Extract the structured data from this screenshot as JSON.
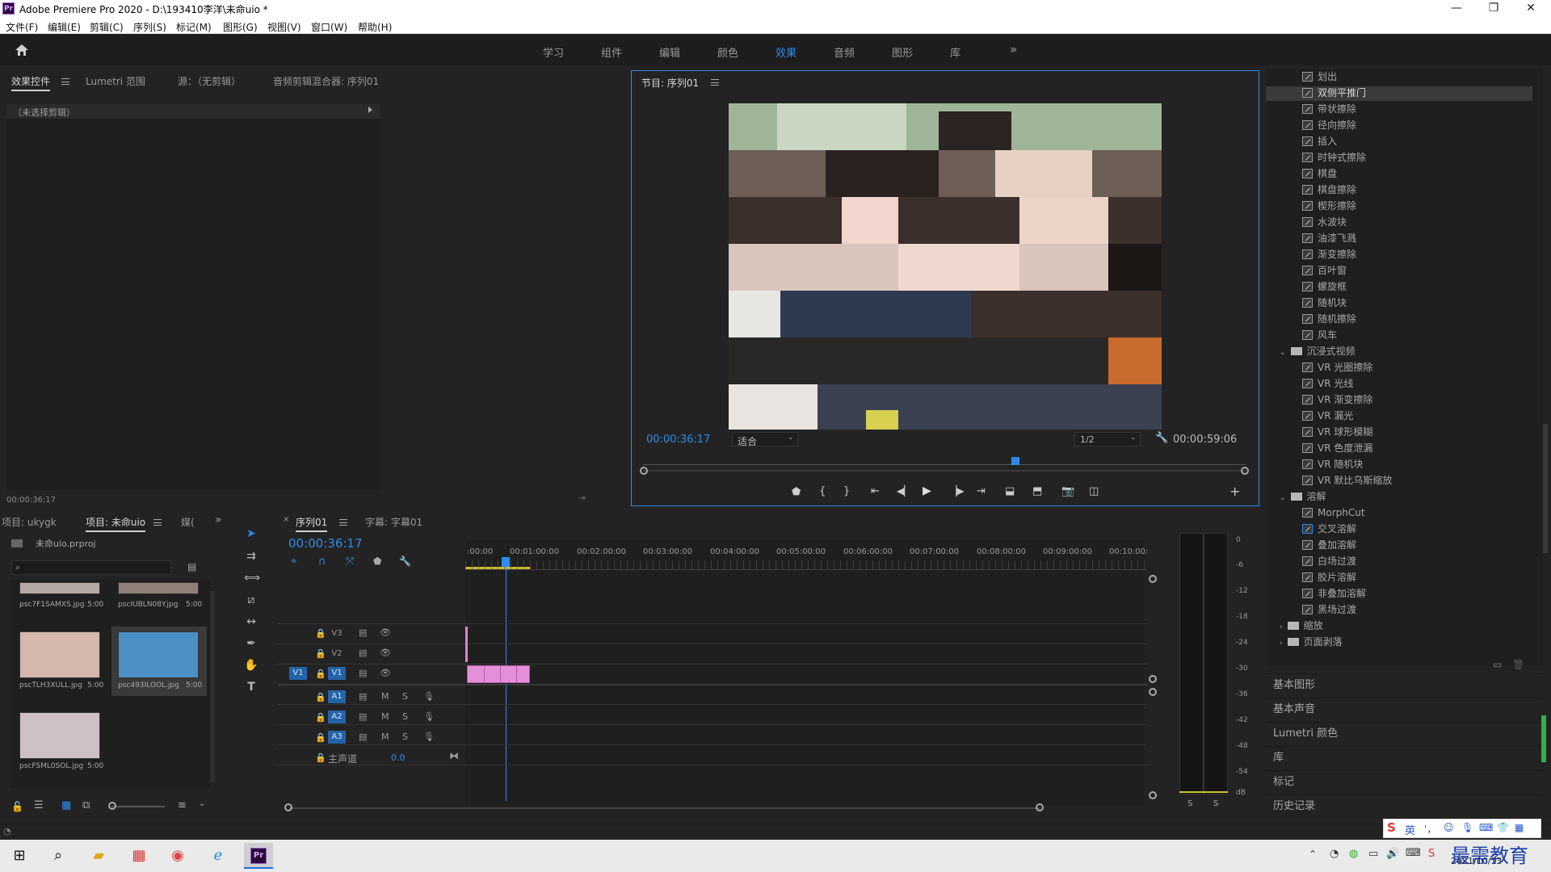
{
  "window": {
    "app_badge": "Pr",
    "title": "Adobe Premiere Pro 2020 - D:\\193410李洋\\未命uio *",
    "minimize": "—",
    "restore": "❐",
    "close": "✕"
  },
  "menu": [
    "文件(F)",
    "编辑(E)",
    "剪辑(C)",
    "序列(S)",
    "标记(M)",
    "图形(G)",
    "视图(V)",
    "窗口(W)",
    "帮助(H)"
  ],
  "workspaces": [
    "学习",
    "组件",
    "编辑",
    "颜色",
    "效果",
    "音频",
    "图形",
    "库"
  ],
  "workspace_active": "效果",
  "workspace_more": "»",
  "source_panel": {
    "tabs": [
      "效果控件",
      "Lumetri 范围",
      "源：（无剪辑）",
      "音频剪辑混合器: 序列01"
    ],
    "no_clip": "（未选择剪辑）",
    "timecode": "00:00:36:17"
  },
  "program": {
    "tab": "节目: 序列01",
    "timecode": "00:00:36:17",
    "fit": "适合",
    "resolution": "1/2",
    "duration": "00:00:59:06"
  },
  "project_panel": {
    "tabs": [
      "项目: ukygk",
      "项目: 未命uio",
      "媒("
    ],
    "project_file": "未命uio.prproj",
    "items": [
      {
        "name": "psc7F1SAMXS.jpg",
        "dur": "5:00"
      },
      {
        "name": "pscIUBLN08Y.jpg",
        "dur": "5:00"
      },
      {
        "name": "pscTLH3XULL.jpg",
        "dur": "5:00"
      },
      {
        "name": "psc493ILOOL.jpg",
        "dur": "5:00"
      },
      {
        "name": "pscFSML0SOL.jpg",
        "dur": "5:00"
      }
    ]
  },
  "timeline": {
    "tabs": [
      "序列01",
      "字幕: 字幕01"
    ],
    "timecode": "00:00:36:17",
    "ruler": [
      ":00:00",
      "00:01:00:00",
      "00:02:00:00",
      "00:03:00:00",
      "00:04:00:00",
      "00:05:00:00",
      "00:06:00:00",
      "00:07:00:00",
      "00:08:00:00",
      "00:09:00:00",
      "00:10:00:"
    ],
    "video_tracks": [
      "V3",
      "V2",
      "V1"
    ],
    "audio_tracks": [
      "A1",
      "A2",
      "A3"
    ],
    "source_patch": "V1",
    "mute": "M",
    "solo": "S",
    "master_label": "主声道",
    "master_value": "0.0"
  },
  "meter": {
    "scale": [
      "0",
      "-6",
      "-12",
      "-18",
      "-24",
      "-30",
      "-36",
      "-42",
      "-48",
      "-54",
      "dB"
    ],
    "solo_buttons": [
      "S",
      "S"
    ]
  },
  "effects": {
    "items_top": [
      "划出",
      "双侧平推门",
      "带状擦除",
      "径向擦除",
      "插入",
      "时钟式擦除",
      "棋盘",
      "棋盘擦除",
      "楔形擦除",
      "水波块",
      "油漆飞溅",
      "渐变擦除",
      "百叶窗",
      "螺旋框",
      "随机块",
      "随机擦除",
      "风车"
    ],
    "highlight": "双侧平推门",
    "folder_immersive": "沉浸式视频",
    "items_immersive": [
      "VR 光圈擦除",
      "VR 光线",
      "VR 渐变擦除",
      "VR 漏光",
      "VR 球形模糊",
      "VR 色度泄漏",
      "VR 随机块",
      "VR 默比乌斯缩放"
    ],
    "folder_dissolve": "溶解",
    "items_dissolve": [
      "MorphCut",
      "交叉溶解",
      "叠加溶解",
      "白场过渡",
      "胶片溶解",
      "非叠加溶解",
      "黑场过渡"
    ],
    "folder_zoom": "缩放",
    "folder_page": "页面剥落",
    "sections": [
      "基本图形",
      "基本声音",
      "Lumetri 颜色",
      "库",
      "标记",
      "历史记录"
    ]
  },
  "taskbar": {
    "date": "2021/10/13",
    "watermark": "最需教育",
    "ime": "英"
  }
}
